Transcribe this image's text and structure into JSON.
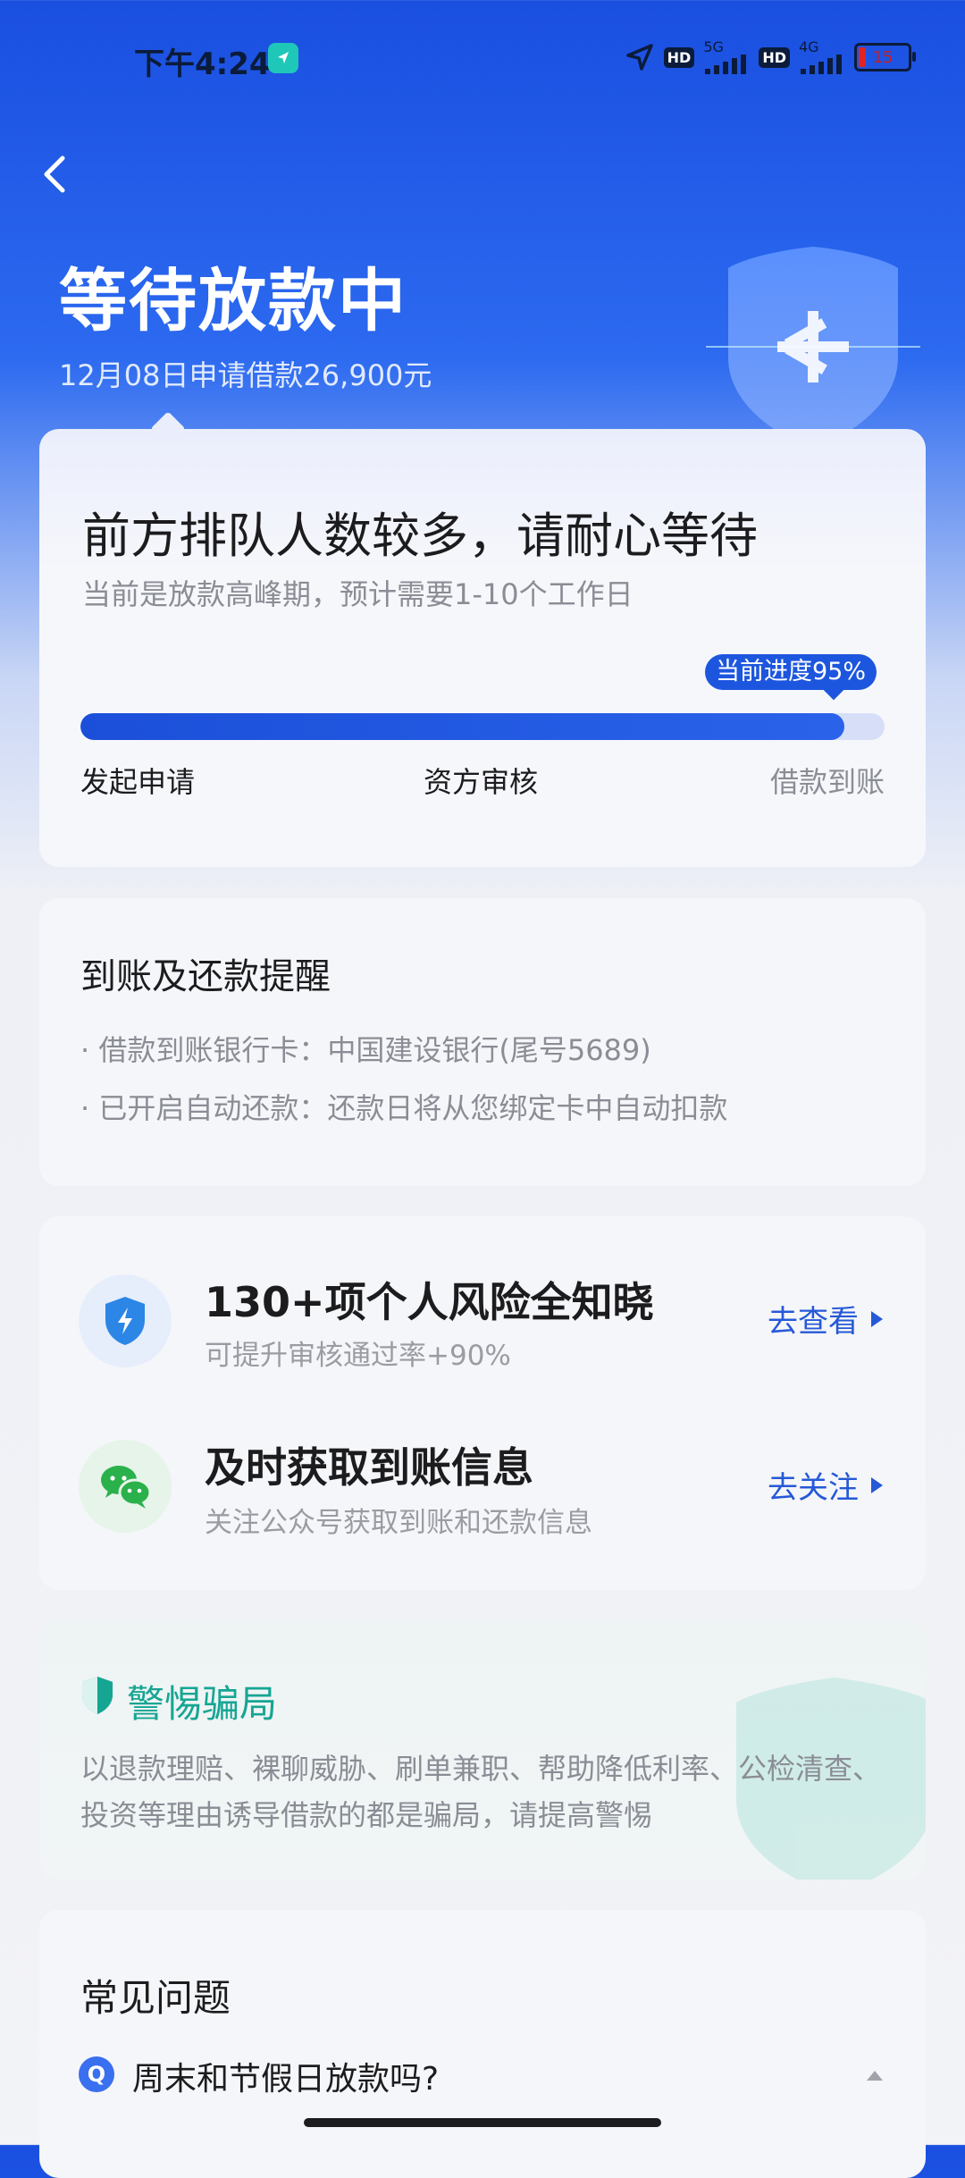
{
  "status_bar": {
    "time": "下午4:24",
    "hd1": "HD",
    "net1": "5G",
    "hd2": "HD",
    "net2": "4G",
    "battery": "15"
  },
  "header": {
    "title": "等待放款中",
    "subtitle": "12月08日申请借款26,900元"
  },
  "status_card": {
    "headline": "前方排队人数较多，请耐心等待",
    "description": "当前是放款高峰期，预计需要1-10个工作日",
    "progress_label": "当前进度95%",
    "progress_value": 0.95,
    "steps": [
      "发起申请",
      "资方审核",
      "借款到账"
    ]
  },
  "reminder": {
    "title": "到账及还款提醒",
    "items": [
      "· 借款到账银行卡：中国建设银行(尾号5689)",
      "· 已开启自动还款：还款日将从您绑定卡中自动扣款"
    ]
  },
  "actions": [
    {
      "title": "130+项个人风险全知晓",
      "subtitle": "可提升审核通过率+90%",
      "link": "去查看",
      "icon": "shield-bolt-icon"
    },
    {
      "title": "及时获取到账信息",
      "subtitle": "关注公众号获取到账和还款信息",
      "link": "去关注",
      "icon": "wechat-icon"
    }
  ],
  "fraud": {
    "title": "警惕骗局",
    "body": "以退款理赔、裸聊威胁、刷单兼职、帮助降低利率、公检清查、投资等理由诱导借款的都是骗局，请提高警惕"
  },
  "faq": {
    "title": "常见问题",
    "badge": "Q",
    "question": "周末和节假日放款吗?"
  },
  "colors": {
    "primary": "#1d56de",
    "link": "#2659d7",
    "fraud_accent": "#16a593",
    "wechat": "#2bb14b"
  }
}
